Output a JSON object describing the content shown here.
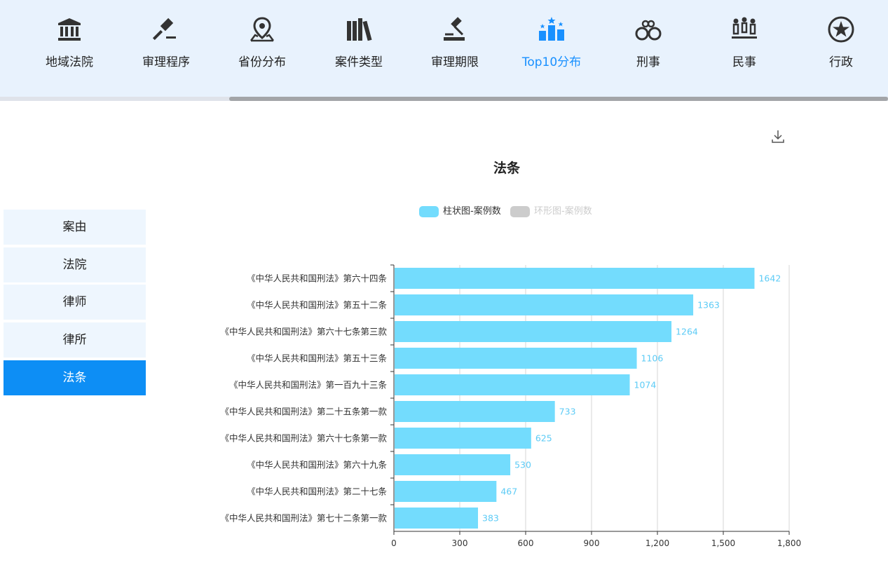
{
  "nav": {
    "items": [
      {
        "label": "地域法院",
        "icon": "courthouse-icon"
      },
      {
        "label": "审理程序",
        "icon": "gavel-icon"
      },
      {
        "label": "省份分布",
        "icon": "map-pin-icon"
      },
      {
        "label": "案件类型",
        "icon": "books-icon"
      },
      {
        "label": "审理期限",
        "icon": "judge-hammer-icon"
      },
      {
        "label": "Top10分布",
        "icon": "podium-stars-icon"
      },
      {
        "label": "刑事",
        "icon": "handcuffs-icon"
      },
      {
        "label": "民事",
        "icon": "people-icon"
      },
      {
        "label": "行政",
        "icon": "star-badge-icon"
      }
    ],
    "active_index": 5,
    "active_color": "#1890ff"
  },
  "sidebar": {
    "tabs": [
      "案由",
      "法院",
      "律师",
      "律所",
      "法条"
    ],
    "active_index": 4,
    "active_color": "#0d8ef5"
  },
  "chart": {
    "download_icon": "download-icon",
    "legend": [
      {
        "label": "柱状图-案例数",
        "color": "#73dcfd",
        "active": true
      },
      {
        "label": "环形图-案例数",
        "color": "#cccccc",
        "active": false
      }
    ]
  },
  "chart_data": {
    "type": "bar",
    "orientation": "horizontal",
    "title": "法条",
    "categories": [
      "《中华人民共和国刑法》第六十四条",
      "《中华人民共和国刑法》第五十二条",
      "《中华人民共和国刑法》第六十七条第三款",
      "《中华人民共和国刑法》第五十三条",
      "《中华人民共和国刑法》第一百九十三条",
      "《中华人民共和国刑法》第二十五条第一款",
      "《中华人民共和国刑法》第六十七条第一款",
      "《中华人民共和国刑法》第六十九条",
      "《中华人民共和国刑法》第二十七条",
      "《中华人民共和国刑法》第七十二条第一款"
    ],
    "series": [
      {
        "name": "柱状图-案例数",
        "values": [
          1642,
          1363,
          1264,
          1106,
          1074,
          733,
          625,
          530,
          467,
          383
        ]
      }
    ],
    "xlim": [
      0,
      1800
    ],
    "xticks": [
      "0",
      "300",
      "600",
      "900",
      "1,200",
      "1,500",
      "1,800"
    ],
    "bar_color": "#73dcfd",
    "label_color": "#5ccbf6",
    "grid": true,
    "legend_position": "top-center"
  }
}
